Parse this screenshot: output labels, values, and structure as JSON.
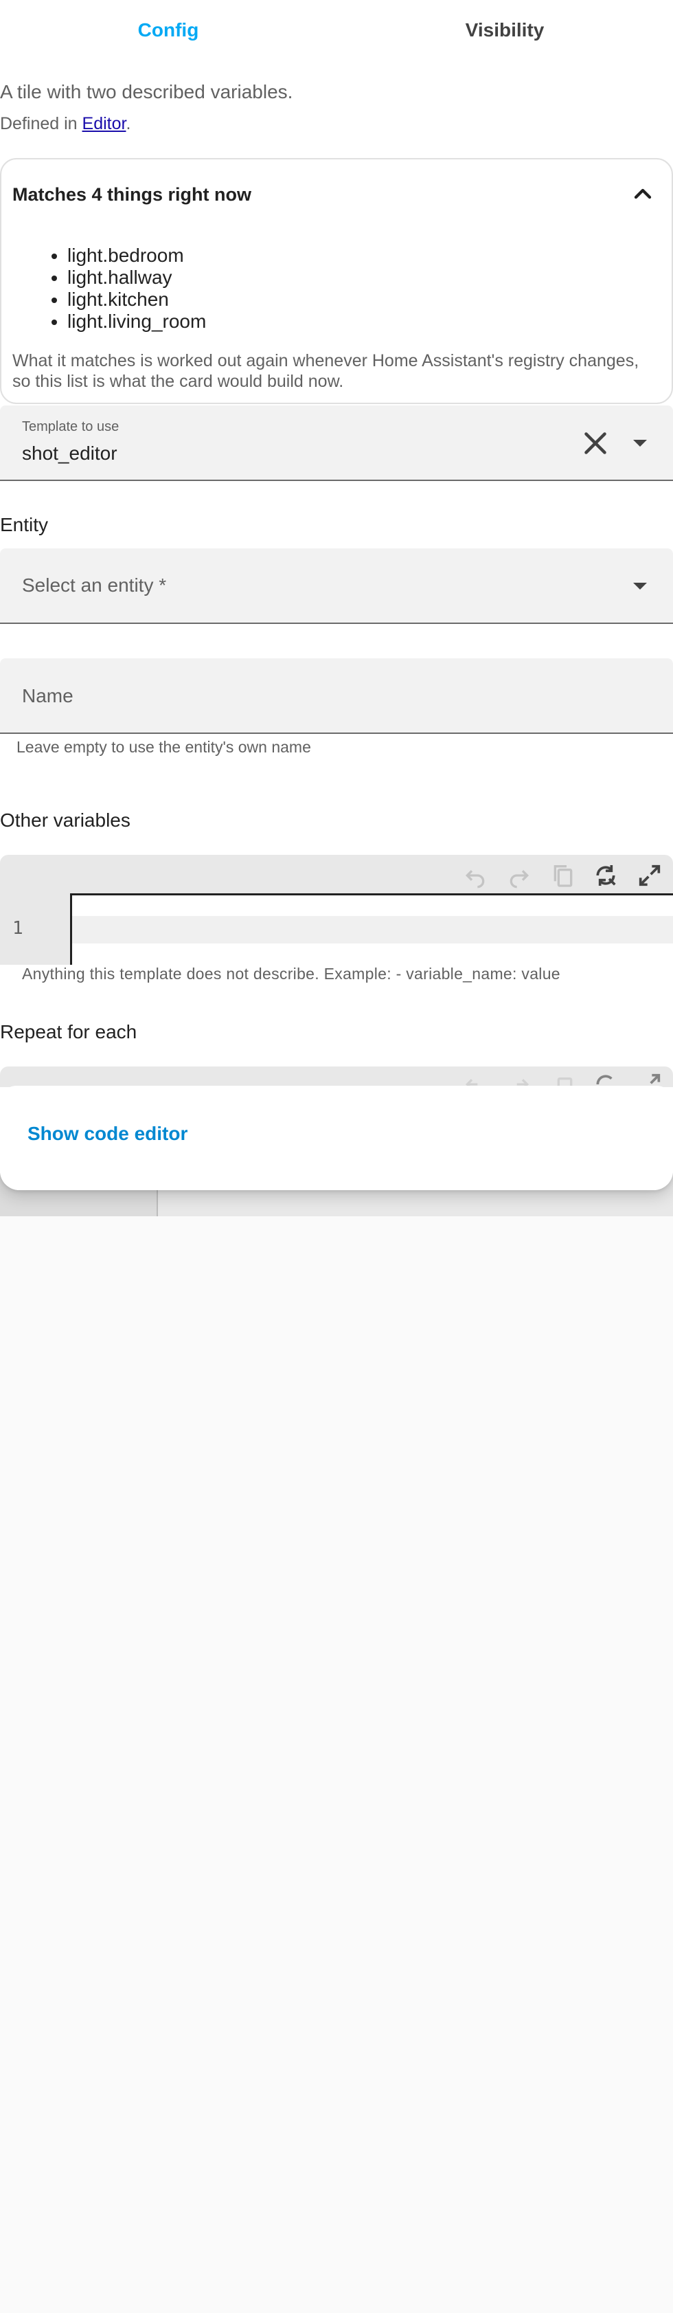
{
  "tabs": [
    {
      "label": "Config",
      "active": true
    },
    {
      "label": "Visibility",
      "active": false
    }
  ],
  "description": "A tile with two described variables.",
  "defined_in": {
    "prefix": "Defined in ",
    "link": "Editor",
    "suffix": "."
  },
  "matches": {
    "title": "Matches 4 things right now",
    "items": [
      "light.bedroom",
      "light.hallway",
      "light.kitchen",
      "light.living_room"
    ],
    "note": "What it matches is worked out again whenever Home Assistant's registry changes, so this list is what the card would build now."
  },
  "template_field": {
    "label": "Template to use",
    "value": "shot_editor"
  },
  "entity": {
    "title": "Entity",
    "placeholder": "Select an entity *"
  },
  "name_field": {
    "placeholder": "Name",
    "helper": "Leave empty to use the entity's own name"
  },
  "other_variables": {
    "title": "Other variables",
    "line_number": "1",
    "helper": "Anything this template does not describe. Example: - variable_name: value"
  },
  "repeat": {
    "title": "Repeat for each"
  },
  "footer": {
    "show_code_label": "Show code editor"
  },
  "colors": {
    "accent": "#03a9f4",
    "link": "#1a0dab",
    "field_bg": "#f2f2f2"
  },
  "icons": [
    "chevron-up-icon",
    "close-icon",
    "dropdown-arrow-icon",
    "undo-icon",
    "redo-icon",
    "copy-icon",
    "refresh-icon",
    "fullscreen-icon"
  ]
}
